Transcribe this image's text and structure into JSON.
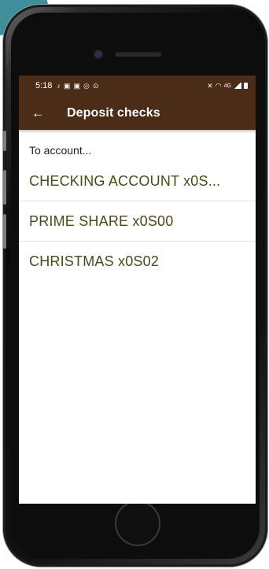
{
  "status_bar": {
    "time": "5:18",
    "left_icons": [
      "tiktok-icon",
      "teams-icon",
      "teams-icon",
      "instagram-icon",
      "record-icon"
    ],
    "right_icons": [
      "mute-icon",
      "wifi-icon",
      "lte-icon",
      "signal-icon",
      "battery-icon"
    ]
  },
  "app_bar": {
    "title": "Deposit checks",
    "back_icon": "arrow-left-icon"
  },
  "content": {
    "section_label": "To account...",
    "accounts": [
      {
        "name": "CHECKING ACCOUNT x0S..."
      },
      {
        "name": "PRIME SHARE x0S00"
      },
      {
        "name": "CHRISTMAS x0S02"
      }
    ]
  },
  "colors": {
    "app_bar_bg": "#4a2c17",
    "account_text": "#4a4a1a",
    "divider": "#e4e4e4",
    "decor_teal": "#3f8e9a"
  }
}
